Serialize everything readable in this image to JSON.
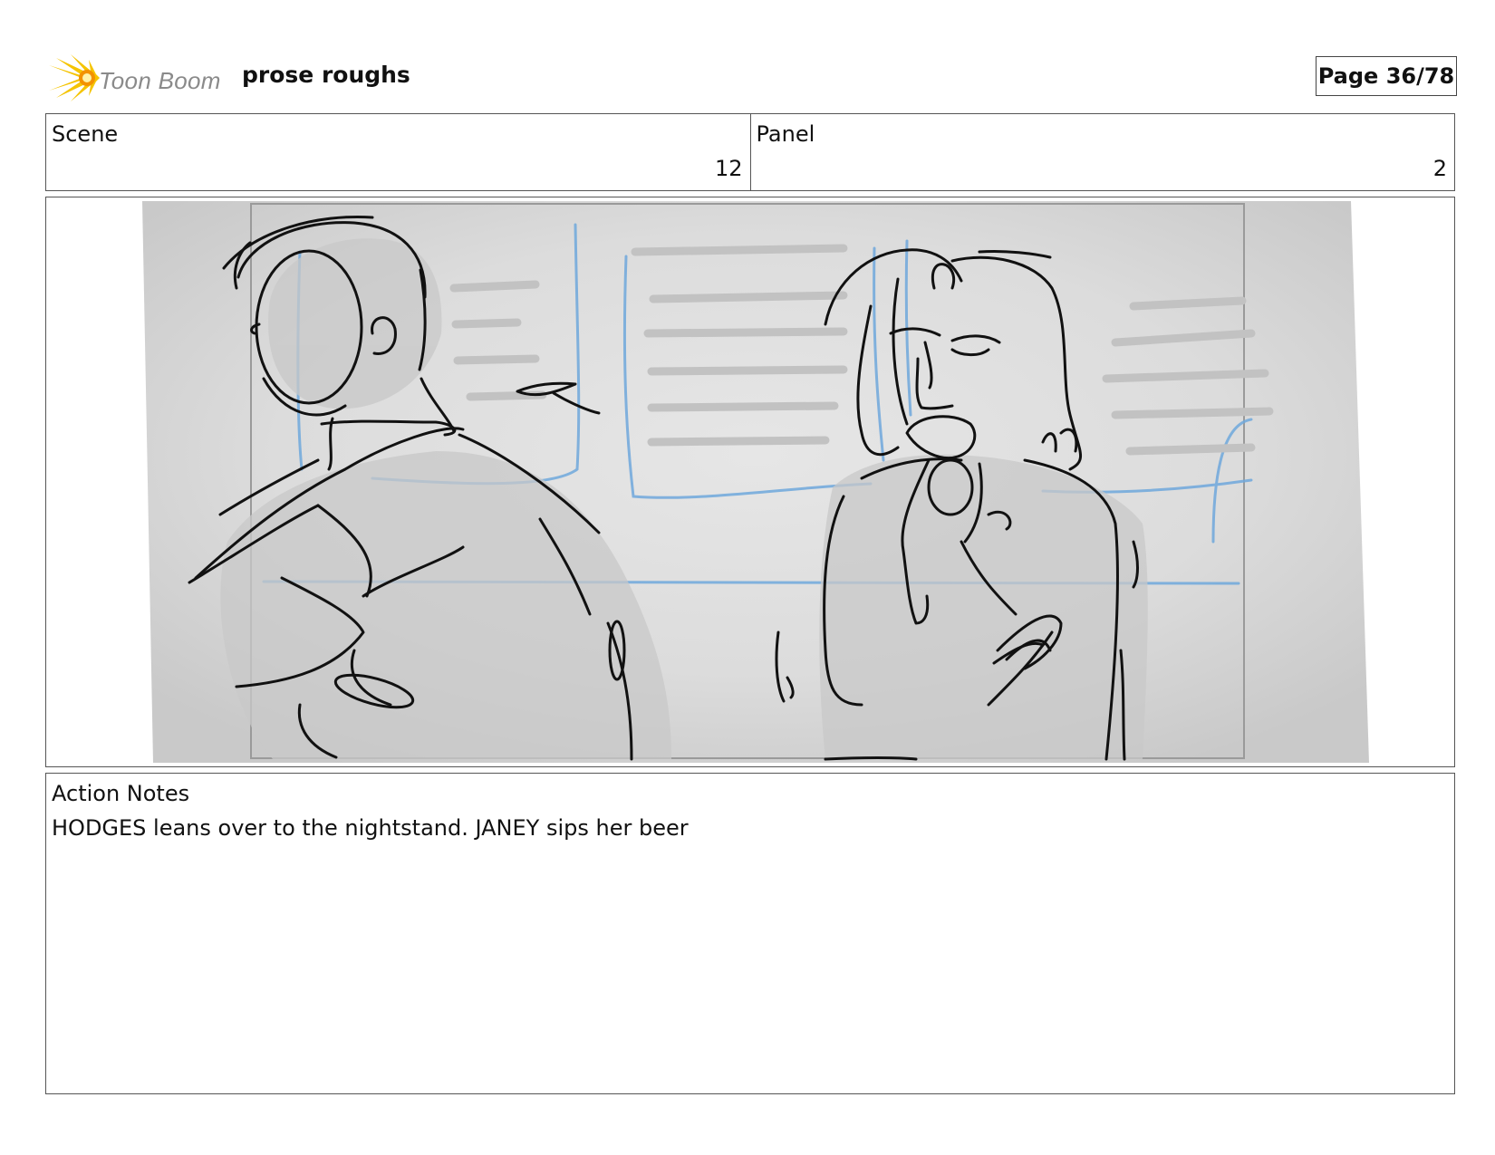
{
  "header": {
    "brand": "Toon Boom",
    "logo_icon": "starburst-icon",
    "project_title": "prose roughs",
    "page_label": "Page 36/78"
  },
  "info": {
    "scene_label": "Scene",
    "scene_value": "12",
    "panel_label": "Panel",
    "panel_value": "2"
  },
  "panel": {
    "image": "storyboard-sketch"
  },
  "notes": {
    "label": "Action Notes",
    "text": "HODGES leans over to the nightstand. JANEY sips her beer"
  },
  "colors": {
    "logo_yellow": "#f5c400",
    "logo_orange": "#f39200",
    "sketch_blue": "#6fa8dc",
    "border": "#555555"
  }
}
